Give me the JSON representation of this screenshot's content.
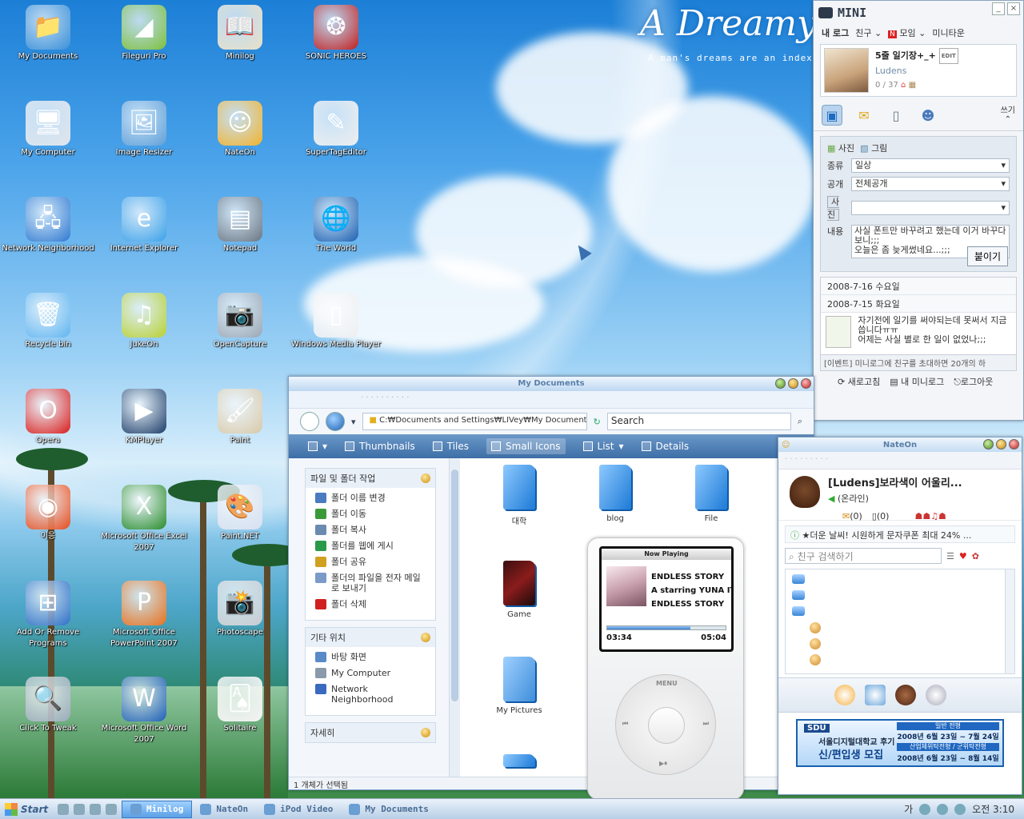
{
  "wallpaper": {
    "title": "A Dreamy",
    "subtitle": "A man's dreams are an index"
  },
  "desktop_icons": [
    {
      "label": "My Documents",
      "icon": "folder-icon",
      "col": 0,
      "row": 0,
      "color": "#3a8fd8",
      "glyph": "📁"
    },
    {
      "label": "Fileguri Pro",
      "icon": "fileguri-icon",
      "col": 1,
      "row": 0,
      "color": "#7cc03a",
      "glyph": "◢"
    },
    {
      "label": "Minilog",
      "icon": "book-icon",
      "col": 2,
      "row": 0,
      "color": "#e8e0c8",
      "glyph": "📖"
    },
    {
      "label": "SONIC HEROES",
      "icon": "sonic-icon",
      "col": 3,
      "row": 0,
      "color": "#c02020",
      "glyph": "❂"
    },
    {
      "label": "My Computer",
      "icon": "computer-icon",
      "col": 0,
      "row": 1,
      "color": "#e0e4ea",
      "glyph": "🖥"
    },
    {
      "label": "Image Resizer",
      "icon": "image-icon",
      "col": 1,
      "row": 1,
      "color": "#5f9fd8",
      "glyph": "🖼"
    },
    {
      "label": "NateOn",
      "icon": "nateon-icon",
      "col": 2,
      "row": 1,
      "color": "#f2b22a",
      "glyph": "☺"
    },
    {
      "label": "SuperTagEditor",
      "icon": "editor-icon",
      "col": 3,
      "row": 1,
      "color": "#eee",
      "glyph": "✎"
    },
    {
      "label": "Network Neighborhood",
      "icon": "network-icon",
      "col": 0,
      "row": 2,
      "color": "#2f78d0",
      "glyph": "🖧"
    },
    {
      "label": "Internet Explorer",
      "icon": "ie-icon",
      "col": 1,
      "row": 2,
      "color": "#3aa0e8",
      "glyph": "e"
    },
    {
      "label": "Notepad",
      "icon": "notepad-icon",
      "col": 2,
      "row": 2,
      "color": "#6a7480",
      "glyph": "▤"
    },
    {
      "label": "The World",
      "icon": "globe-icon",
      "col": 3,
      "row": 2,
      "color": "#1c5fb0",
      "glyph": "🌐"
    },
    {
      "label": "Recycle bin",
      "icon": "recycle-bin-icon",
      "col": 0,
      "row": 3,
      "color": "#5fb4f0",
      "glyph": "🗑"
    },
    {
      "label": "JukeOn",
      "icon": "jukeon-icon",
      "col": 1,
      "row": 3,
      "color": "#b8d030",
      "glyph": "♫"
    },
    {
      "label": "OpenCapture",
      "icon": "camera-icon",
      "col": 2,
      "row": 3,
      "color": "#9aa6b4",
      "glyph": "📷"
    },
    {
      "label": "Windows Media Player",
      "icon": "ipod-icon",
      "col": 3,
      "row": 3,
      "color": "#eceff2",
      "glyph": "▯"
    },
    {
      "label": "Opera",
      "icon": "opera-icon",
      "col": 0,
      "row": 4,
      "color": "#d81c1c",
      "glyph": "O"
    },
    {
      "label": "KMPlayer",
      "icon": "play-icon",
      "col": 1,
      "row": 4,
      "color": "#1c3c68",
      "glyph": "▶"
    },
    {
      "label": "Paint",
      "icon": "paint-icon",
      "col": 2,
      "row": 4,
      "color": "#d8c8a8",
      "glyph": "🖌"
    },
    {
      "label": "이응",
      "icon": "disc-icon",
      "col": 0,
      "row": 5,
      "color": "#e84c1c",
      "glyph": "◉"
    },
    {
      "label": "Microsoft Office Excel 2007",
      "icon": "excel-icon",
      "col": 1,
      "row": 5,
      "color": "#2a8c2a",
      "glyph": "X"
    },
    {
      "label": "Paint.NET",
      "icon": "paintnet-icon",
      "col": 2,
      "row": 5,
      "color": "#d8e0f0",
      "glyph": "🎨"
    },
    {
      "label": "Add Or Remove Programs",
      "icon": "programs-icon",
      "col": 0,
      "row": 6,
      "color": "#2f6fc8",
      "glyph": "⊞"
    },
    {
      "label": "Microsoft Office PowerPoint 2007",
      "icon": "powerpoint-icon",
      "col": 1,
      "row": 6,
      "color": "#e8701c",
      "glyph": "P"
    },
    {
      "label": "Photoscape",
      "icon": "photoscape-icon",
      "col": 2,
      "row": 6,
      "color": "#c8ccd2",
      "glyph": "📸"
    },
    {
      "label": "Click To Tweak",
      "icon": "magnifier-icon",
      "col": 0,
      "row": 7,
      "color": "#9ab",
      "glyph": "🔍"
    },
    {
      "label": "Microsoft Office Word 2007",
      "icon": "word-icon",
      "col": 1,
      "row": 7,
      "color": "#1c5fb8",
      "glyph": "W"
    },
    {
      "label": "Solitaire",
      "icon": "cards-icon",
      "col": 2,
      "row": 7,
      "color": "#f4f4f4",
      "glyph": "🂡"
    }
  ],
  "mini": {
    "title": "MINI",
    "nav": [
      "내 로그",
      "친구",
      "모임",
      "미니타운"
    ],
    "profile": {
      "name": "5줄 일기장+_+",
      "edit": "EDIT",
      "id": "Ludens",
      "count": "0 / 37"
    },
    "write": "쓰기",
    "tabs": [
      "사진",
      "그림"
    ],
    "form": {
      "type_label": "종류",
      "type_value": "일상",
      "open_label": "공개",
      "open_value": "전체공개",
      "photo_label": "사진",
      "content_label": "내용",
      "content": "사실 폰트만 바꾸려고 했는데 이거 바꾸다보니;;;\n오늘은 좀 늦게썼네요...;;;",
      "submit": "붙이기"
    },
    "list": {
      "dates": [
        "2008-7-16 수요일",
        "2008-7-15 화요일"
      ],
      "entry": "자기전에 일기를 써야되는데 못써서 지금 씁니다ㅠㅠ\n어제는 사실 별로 한 일이 없었나;;;",
      "event": "[이벤트] 미니로그에 친구를 초대하면 20개의 하"
    },
    "footer": [
      "새로고침",
      "내 미니로그",
      "로그아웃"
    ]
  },
  "mydocs": {
    "title": "My Documents",
    "address": "C:₩Documents and Settings₩LIVey₩My Documents",
    "search": "Search",
    "views": [
      "Thumbnails",
      "Tiles",
      "Small Icons",
      "List",
      "Details"
    ],
    "tasks_title": "파일 및 폴더 작업",
    "tasks": [
      "폴더 이름 변경",
      "폴더 이동",
      "폴더 복사",
      "폴더를 웹에 게시",
      "폴더 공유",
      "폴더의 파일을 전자 메일로 보내기",
      "폴더 삭제"
    ],
    "places_title": "기타 위치",
    "places": [
      "바탕 화면",
      "My Computer",
      "Network Neighborhood"
    ],
    "details_title": "자세히",
    "files": [
      "대학",
      "blog",
      "File",
      "Game",
      "My Pictures"
    ],
    "status": "1 개체가 선택됨"
  },
  "ipod": {
    "header": "Now Playing",
    "lines": [
      "ENDLESS STORY",
      "A starring YUNA IT",
      "ENDLESS STORY"
    ],
    "elapsed": "03:34",
    "total": "05:04",
    "progress": 0.7,
    "menu": "MENU",
    "prev": "⏮",
    "next": "⏭",
    "playpause": "▶⏸"
  },
  "nateon": {
    "title": "NateOn",
    "name": "[Ludens]보라색이 어울리...",
    "status": "(온라인)",
    "mail": "(0)",
    "memo": "(0)",
    "ad": "★더운 날씨! 시원하게 문자쿠폰 최대 24% ...",
    "search_placeholder": "친구 검색하기",
    "banner": {
      "logo": "SDU",
      "line1": "서울디지털대학교 후기",
      "line2": "신/편입생 모집",
      "tag1": "일반 전형",
      "date1": "2008년 6월 23일 ~ 7월 24일",
      "tag2": "산업체위탁전형 / 군위탁전형",
      "date2": "2008년 6월 23일 ~ 8월 14일"
    }
  },
  "taskbar": {
    "start": "Start",
    "tasks": [
      "Minilog",
      "NateOn",
      "iPod Video",
      "My Documents"
    ],
    "ime": "가",
    "time": "오전 3:10"
  }
}
